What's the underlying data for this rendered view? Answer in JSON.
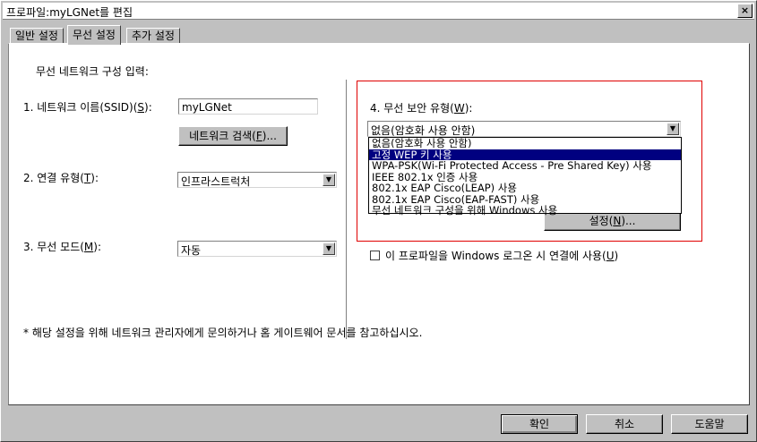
{
  "window": {
    "title": "프로파일:myLGNet를 편집",
    "close_label": "×"
  },
  "tabs": [
    {
      "label": "일반 설정"
    },
    {
      "label": "무선 설정"
    },
    {
      "label": "추가 설정"
    }
  ],
  "left": {
    "section_title": "무선 네트워크 구성 입력:",
    "ssid": {
      "label_pre": "1. 네트워크 이름(SSID)(",
      "label_key": "S",
      "label_post": "):",
      "value": "myLGNet"
    },
    "scan_button": {
      "label_pre": "네트워크 검색(",
      "label_key": "F",
      "label_post": ")..."
    },
    "conn_type": {
      "label_pre": "2. 연결 유형(",
      "label_key": "T",
      "label_post": "):",
      "value": "인프라스트럭처"
    },
    "mode": {
      "label_pre": "3. 무선 모드(",
      "label_key": "M",
      "label_post": "):",
      "value": "자동"
    },
    "footnote": "* 해당 설정을 위해 네트워크 관리자에게 문의하거나 홈 게이트웨어 문서를 참고하십시오."
  },
  "right": {
    "security": {
      "label_pre": "4. 무선 보안 유형(",
      "label_key": "W",
      "label_post": "):",
      "value": "없음(암호화 사용 안함)"
    },
    "options": [
      "없음(암호화 사용 안함)",
      "고정 WEP 키 사용",
      "WPA-PSK(Wi-Fi Protected Access - Pre Shared Key) 사용",
      "IEEE 802.1x 인증 사용",
      "802.1x EAP Cisco(LEAP) 사용",
      "802.1x EAP Cisco(EAP-FAST) 사용",
      "무선 네트워크 구성을 위해 Windows 사용"
    ],
    "settings_button": {
      "label_pre": "설정(",
      "label_key": "N",
      "label_post": ")..."
    },
    "logon_check": {
      "label_pre": "이 프로파일을 Windows 로그온 시 연결에 사용(",
      "label_key": "U",
      "label_post": ")",
      "checked": false
    }
  },
  "buttons": {
    "ok": "확인",
    "cancel": "취소",
    "help": "도움말"
  }
}
